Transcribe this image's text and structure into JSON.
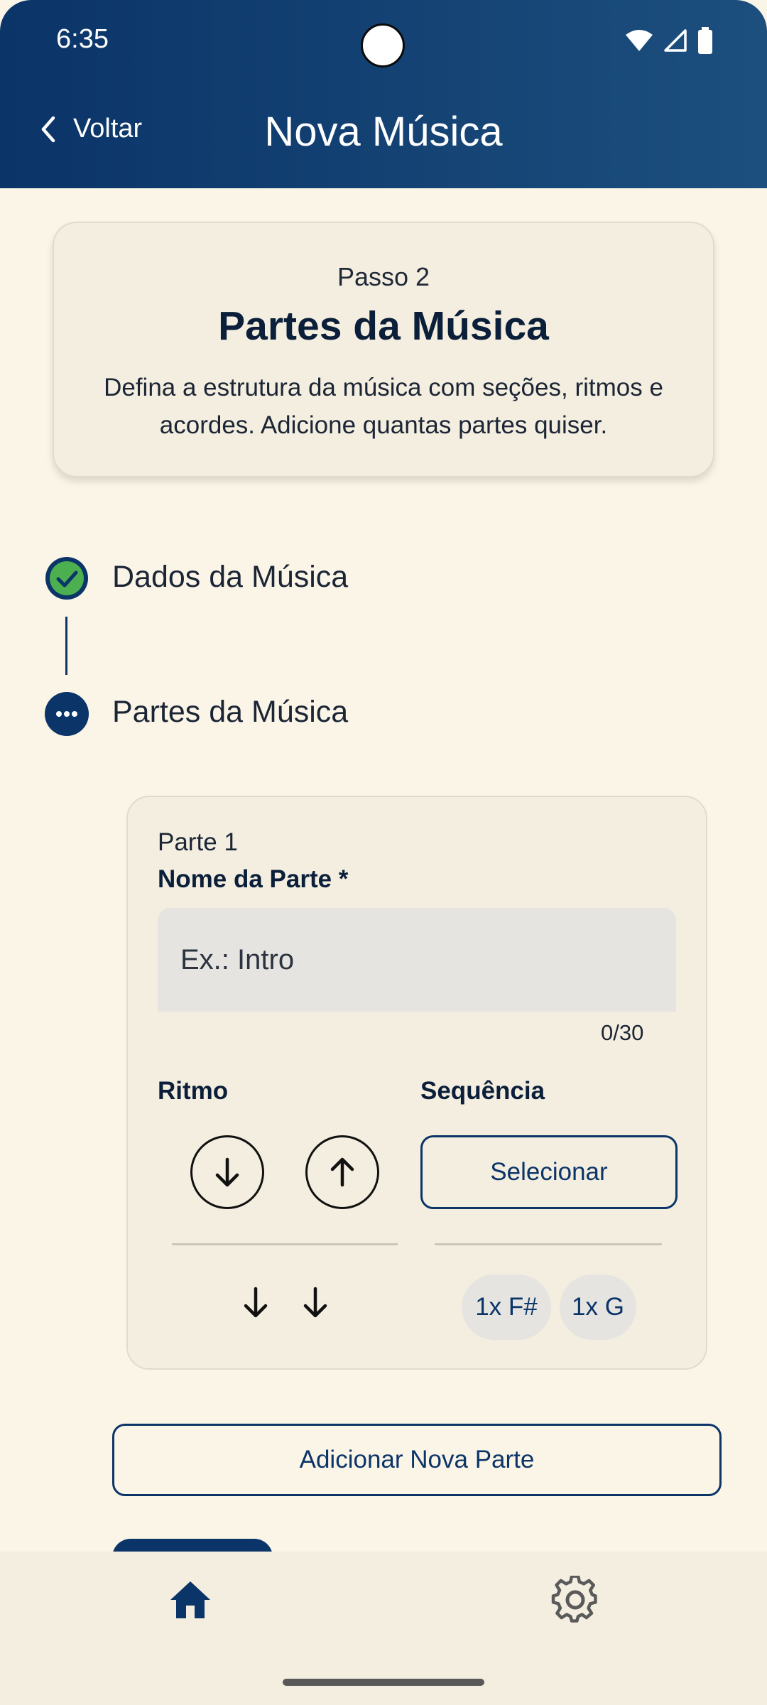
{
  "status_bar": {
    "time": "6:35",
    "icons": [
      "wifi-icon",
      "signal-icon",
      "battery-icon"
    ]
  },
  "header": {
    "back_label": "Voltar",
    "title": "Nova Música"
  },
  "step_card": {
    "step_label": "Passo 2",
    "title": "Partes da Música",
    "description": "Defina a estrutura da música com seções, ritmos e acordes. Adicione quantas partes quiser."
  },
  "stepper": [
    {
      "label": "Dados da Música",
      "state": "completed"
    },
    {
      "label": "Partes da Música",
      "state": "current"
    }
  ],
  "part": {
    "number_label": "Parte 1",
    "name_field": {
      "label": "Nome da Parte *",
      "placeholder": "Ex.: Intro",
      "value": "",
      "counter": "0/30"
    },
    "rhythm": {
      "label": "Ritmo",
      "buttons": [
        "arrow-down-icon",
        "arrow-up-icon"
      ],
      "pattern": [
        "down",
        "down"
      ]
    },
    "sequence": {
      "label": "Sequência",
      "select_label": "Selecionar",
      "chips": [
        "1x F#",
        "1x G"
      ]
    }
  },
  "add_part_label": "Adicionar Nova Parte",
  "bottom_nav": {
    "items": [
      "home-icon",
      "settings-icon"
    ],
    "active": "home-icon"
  },
  "colors": {
    "primary": "#0B3468",
    "background": "#FBF5E8",
    "card": "#F4EEE0",
    "success": "#4CAF50"
  }
}
